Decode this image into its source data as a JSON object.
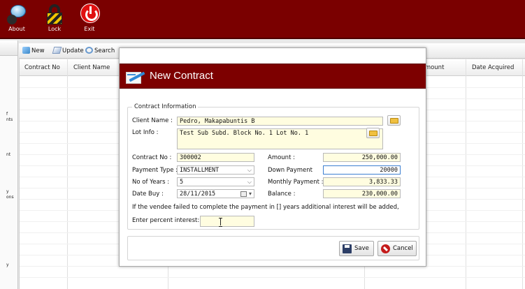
{
  "topbar": {
    "buttons": [
      {
        "label": "About",
        "icon": "about-icon"
      },
      {
        "label": "Lock",
        "icon": "lock-icon"
      },
      {
        "label": "Exit",
        "icon": "exit-icon"
      }
    ]
  },
  "toolbar": {
    "new_label": "New",
    "update_label": "Update",
    "search_label": "Search"
  },
  "grid": {
    "columns": [
      "Contract No",
      "Client Name",
      "Amount",
      "Date Acquired"
    ]
  },
  "left_pane_fragments": [
    "f",
    "nts",
    "nt",
    "y",
    "ons",
    "y"
  ],
  "modal": {
    "title": "New Contract",
    "group_label": "Contract Information",
    "client_name_label": "Client Name :",
    "client_name_value": "Pedro, Makapabuntis B",
    "lot_info_label": "Lot Info :",
    "lot_info_value": "Test Sub Subd.  Block No. 1 Lot No. 1",
    "contract_no_label": "Contract No :",
    "contract_no_value": "300002",
    "amount_label": "Amount :",
    "amount_value": "250,000.00",
    "payment_type_label": "Payment Type :",
    "payment_type_value": "INSTALLMENT",
    "down_payment_label": "Down Payment",
    "down_payment_value": "20000",
    "years_label": "No of Years :",
    "years_value": "5",
    "monthly_label": "Monthly Payment :",
    "monthly_value": "3,833.33",
    "date_buy_label": "Date Buy :",
    "date_buy_value": "28/11/2015",
    "balance_label": "Balance :",
    "balance_value": "230,000.00",
    "notice": "If the vendee failed to complete the payment in [] years additional interest will be added,",
    "interest_label": "Enter percent interest:",
    "interest_value": "",
    "save_label": "Save",
    "cancel_label": "Cancel"
  }
}
